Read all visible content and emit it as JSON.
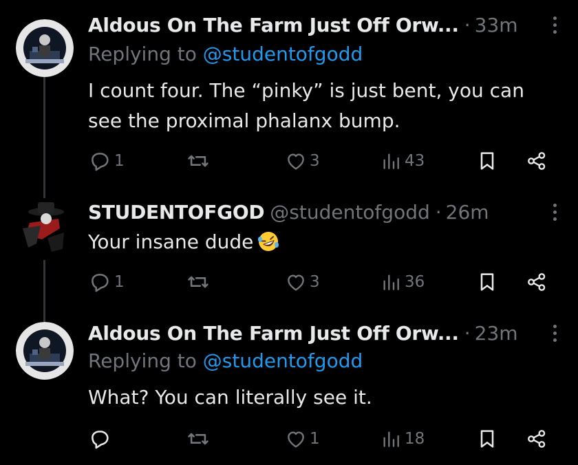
{
  "tweets": [
    {
      "name": "Aldous On The Farm Just Off Orw...",
      "handle": "",
      "time": "33m",
      "reply_prefix": "Replying to ",
      "reply_handle": "@studentofgodd",
      "text_line1": "I count four.  The “pinky” is just bent, you can",
      "text_line2": "see the proximal phalanx bump.",
      "replies": "1",
      "reposts": "",
      "likes": "3",
      "views": "43"
    },
    {
      "name": "STUDENTOFGOD",
      "handle": "@studentofgodd",
      "time": "26m",
      "text_line1": "Your insane dude",
      "replies": "1",
      "reposts": "",
      "likes": "3",
      "views": "36"
    },
    {
      "name": "Aldous On The Farm Just Off Orw...",
      "handle": "",
      "time": "23m",
      "reply_prefix": "Replying to ",
      "reply_handle": "@studentofgodd",
      "text_line1": "What?  You can literally see it.",
      "replies": "",
      "reposts": "",
      "likes": "1",
      "views": "18"
    }
  ],
  "colors": {
    "background": "#000000",
    "text": "#e7e9ea",
    "muted": "#71767b",
    "link": "#1d9bf0",
    "thread_line": "#333639"
  },
  "icons": [
    "reply-icon",
    "repost-icon",
    "like-icon",
    "views-icon",
    "bookmark-icon",
    "share-icon",
    "more-icon",
    "laughing-emoji"
  ]
}
